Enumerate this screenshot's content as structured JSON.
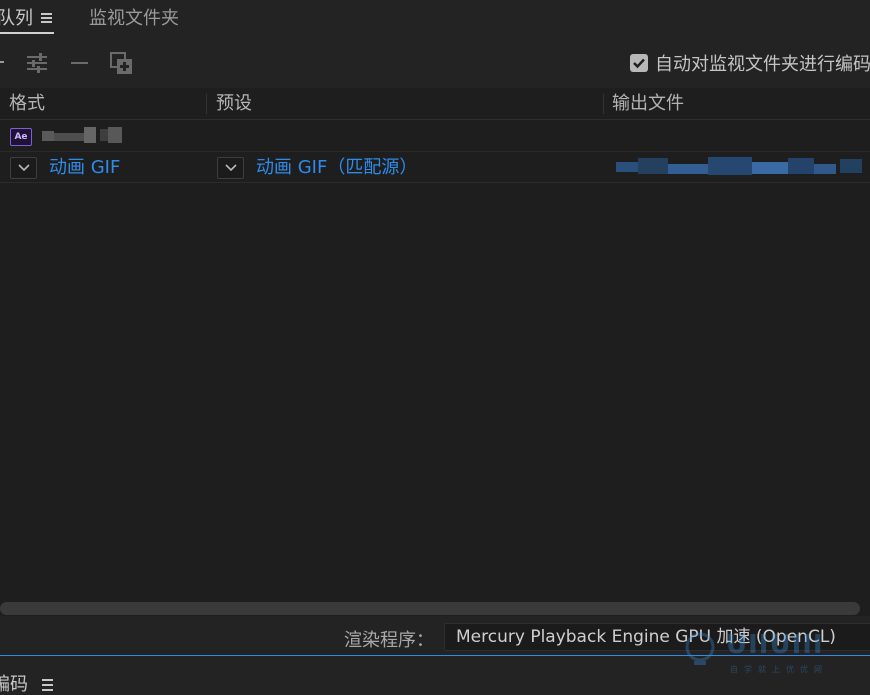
{
  "tabs": {
    "queue_label": "队列",
    "watch_label": "监视文件夹"
  },
  "toolbar": {
    "auto_encode_label": "自动对监视文件夹进行编码",
    "auto_encode_checked": true
  },
  "table": {
    "columns": [
      "格式",
      "预设",
      "输出文件"
    ]
  },
  "source_item": {
    "icon_text": "Ae"
  },
  "output_item": {
    "format": "动画 GIF",
    "preset": "动画 GIF（匹配源）"
  },
  "renderer": {
    "label": "渲染程序：",
    "value": "Mercury Playback Engine GPU 加速 (OpenCL)"
  },
  "bottom_tab": {
    "label": "编码"
  },
  "watermark": {
    "text": "UIIUIII",
    "sub": "自学就上优优网"
  },
  "colors": {
    "accent": "#2d8ceb",
    "panel_bg": "#1e1e1e",
    "chrome_bg": "#232323"
  }
}
